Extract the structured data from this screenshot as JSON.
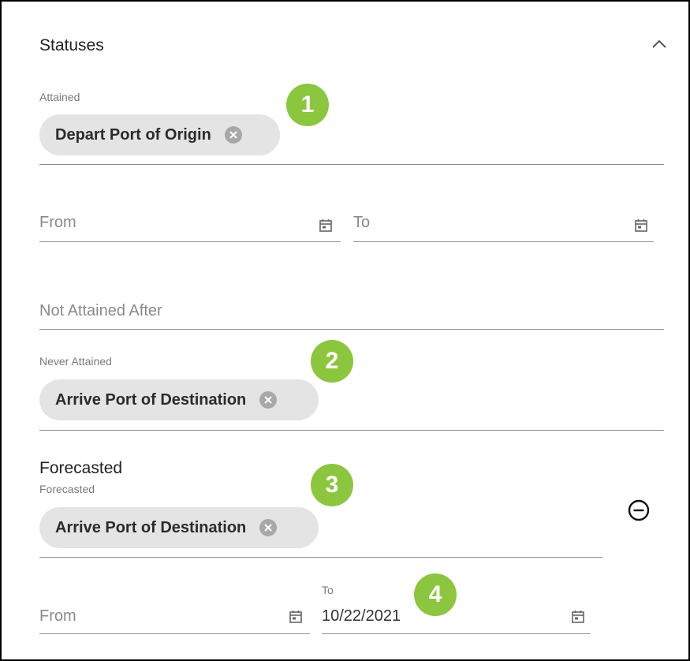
{
  "statuses": {
    "title": "Statuses",
    "collapse_icon": "chevron-up-icon"
  },
  "attained": {
    "label": "Attained",
    "chips": [
      {
        "label": "Depart Port of Origin"
      }
    ],
    "badge": "1"
  },
  "attained_range": {
    "from_placeholder": "From",
    "to_placeholder": "To",
    "icon": "calendar-icon"
  },
  "not_attained_after": {
    "placeholder": "Not Attained After"
  },
  "never_attained": {
    "label": "Never Attained",
    "chips": [
      {
        "label": "Arrive Port of Destination"
      }
    ],
    "badge": "2"
  },
  "forecasted": {
    "heading": "Forecasted",
    "label": "Forecasted",
    "chips": [
      {
        "label": "Arrive Port of Destination"
      }
    ],
    "badge": "3",
    "remove_icon": "minus-circle-icon"
  },
  "forecasted_range": {
    "from_placeholder": "From",
    "to_label": "To",
    "to_value": "10/22/2021",
    "badge": "4",
    "icon": "calendar-icon"
  },
  "colors": {
    "badge": "#8cc63f",
    "chip_bg": "#e4e4e4",
    "line": "#8f8f8f"
  }
}
